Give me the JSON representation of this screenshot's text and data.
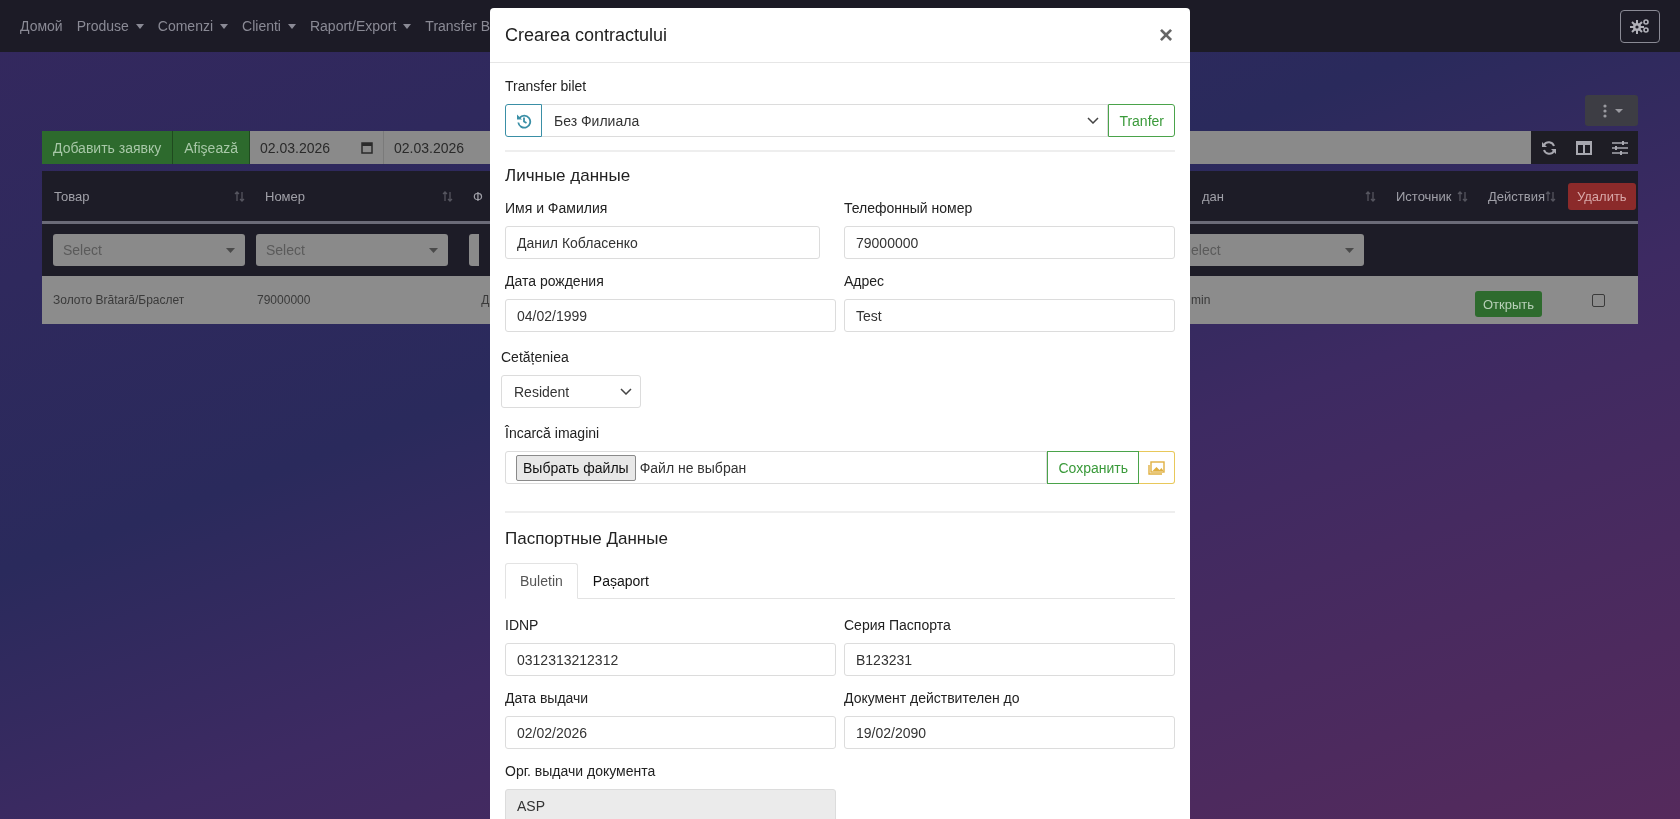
{
  "nav": {
    "items": [
      {
        "label": "Домой",
        "dropdown": false
      },
      {
        "label": "Produse",
        "dropdown": true
      },
      {
        "label": "Comenzi",
        "dropdown": true
      },
      {
        "label": "Clienti",
        "dropdown": true
      },
      {
        "label": "Raport/Export",
        "dropdown": true
      },
      {
        "label": "Transfer B",
        "dropdown": false
      }
    ]
  },
  "toolbar": {
    "buttons": [
      "Добавить заявку",
      "Afişează"
    ],
    "date_from": "02.03.2026",
    "date_to": "02.03.2026"
  },
  "table": {
    "columns": [
      {
        "label": "Товар",
        "sortable": true
      },
      {
        "label": "Номер",
        "sortable": true
      },
      {
        "label": "Ф",
        "sortable": false
      },
      {
        "label": "дан",
        "sortable": true
      },
      {
        "label": "Источник",
        "sortable": true
      },
      {
        "label": "Действия",
        "sortable": true
      }
    ],
    "delete_button": "Удалить",
    "filters": [
      "Select",
      "Select",
      "elect"
    ],
    "rows": [
      {
        "cells": [
          "Золото Brătară/Браслет",
          "79000000",
          "Д",
          "min"
        ],
        "action": "Открыть",
        "checked": false
      }
    ]
  },
  "modal": {
    "title": "Crearea contractului",
    "close": "×",
    "transfer": {
      "label": "Transfer bilet",
      "value": "Без Филиала",
      "button": "Tranfer"
    },
    "personal": {
      "heading": "Личные данные",
      "fields": [
        {
          "label": "Имя и Фамилия",
          "value": "Данил Кобласенко",
          "disabled": false
        },
        {
          "label": "Телефонный номер",
          "value": "79000000",
          "disabled": false
        },
        {
          "label": "Дата рождения",
          "value": "04/02/1999",
          "disabled": false
        },
        {
          "label": "Адрес",
          "value": "Test",
          "disabled": false
        }
      ]
    },
    "citizenship": {
      "label": "Cetățeniea",
      "value": "Resident"
    },
    "upload": {
      "label": "Încarcă imagini",
      "choose_button": "Выбрать файлы",
      "status": "Файл не выбран",
      "save_button": "Сохранить"
    },
    "passport": {
      "heading": "Паспортные Данные",
      "tabs": [
        {
          "label": "Buletin",
          "selected": true
        },
        {
          "label": "Pașaport",
          "selected": false
        }
      ],
      "fields": [
        {
          "label": "IDNP",
          "value": "0312313212312",
          "disabled": false
        },
        {
          "label": "Серия Паспорта",
          "value": "B123231",
          "disabled": false
        },
        {
          "label": "Дата выдачи",
          "value": "02/02/2026",
          "disabled": false
        },
        {
          "label": "Документ действителен до",
          "value": "19/02/2090",
          "disabled": false
        },
        {
          "label": "Орг. выдачи документа",
          "value": "ASP",
          "disabled": true
        }
      ]
    }
  }
}
